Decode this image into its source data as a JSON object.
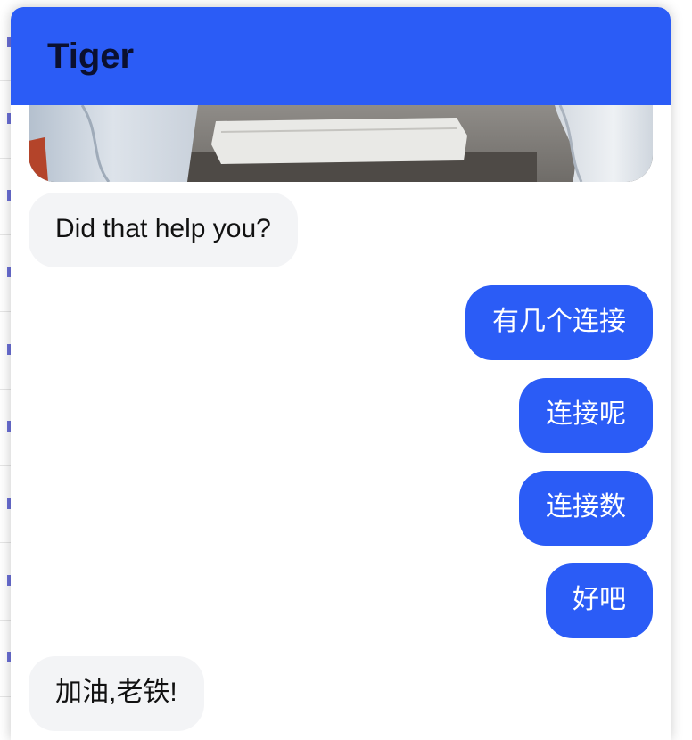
{
  "header": {
    "title": "Tiger"
  },
  "colors": {
    "header_bg": "#2b5cf6",
    "user_bubble": "#2b5cf6",
    "bot_bubble": "#f3f4f6"
  },
  "messages": [
    {
      "sender": "bot",
      "text": "Did that help you?"
    },
    {
      "sender": "user",
      "text": "有几个连接"
    },
    {
      "sender": "user",
      "text": "连接呢"
    },
    {
      "sender": "user",
      "text": "连接数"
    },
    {
      "sender": "user",
      "text": "好吧"
    },
    {
      "sender": "bot",
      "text": "加油,老铁!"
    }
  ]
}
